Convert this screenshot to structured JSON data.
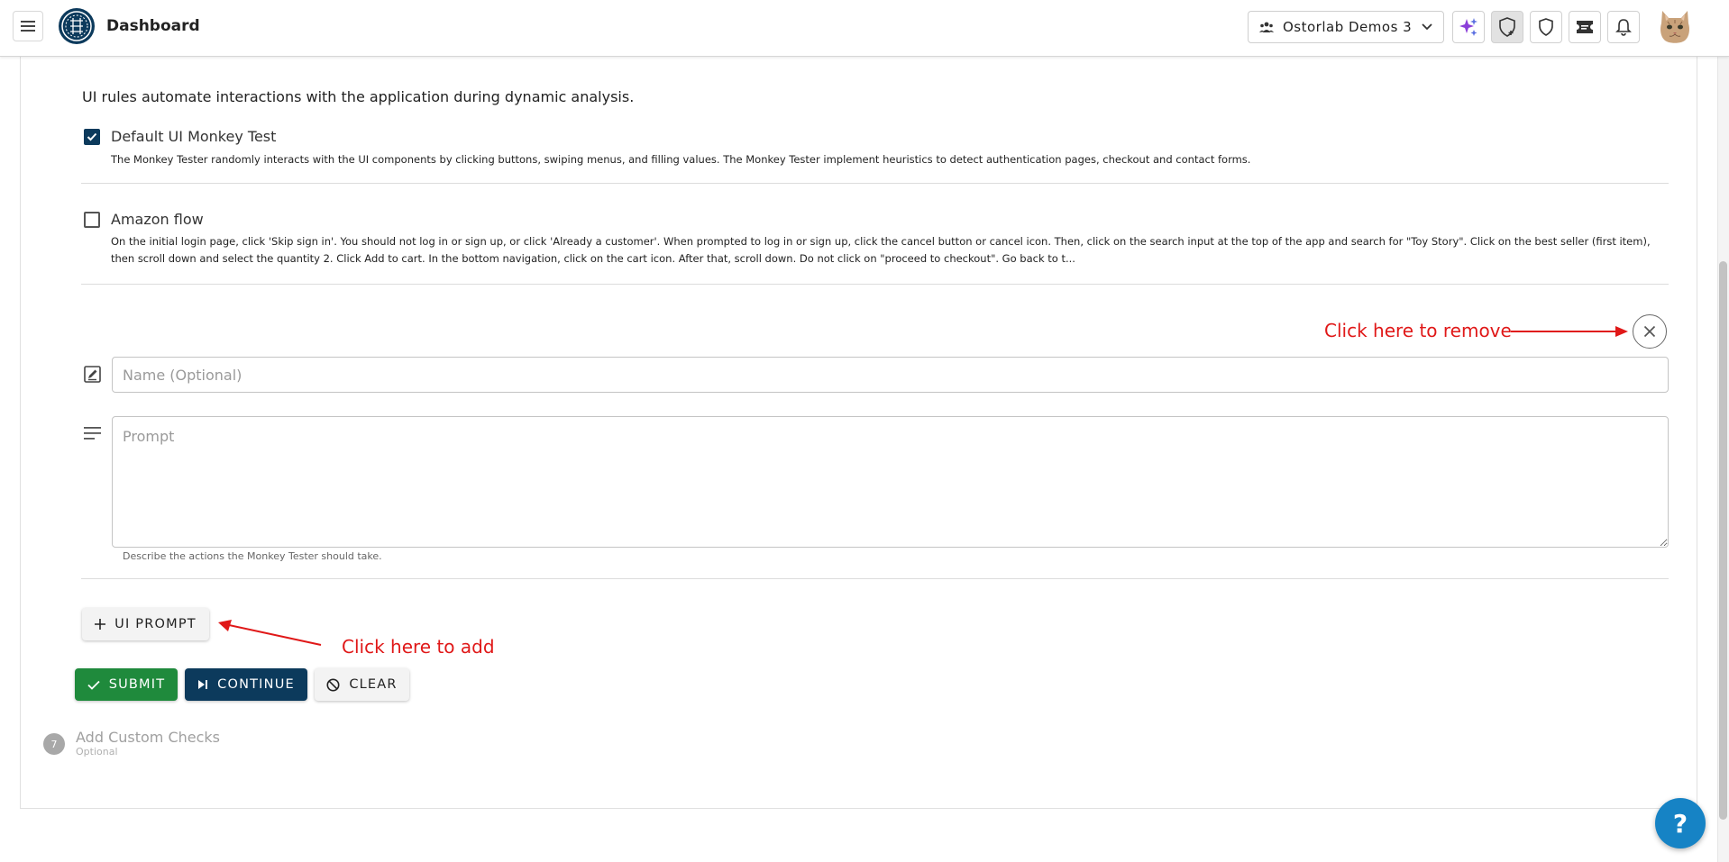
{
  "header": {
    "title": "Dashboard",
    "organization": "Ostorlab Demos 3",
    "icons": [
      "menu-icon",
      "organizations-icon",
      "chevron-down-icon",
      "sparkle-icon",
      "shield-add-icon",
      "shield-icon",
      "ticket-icon",
      "bell-icon"
    ],
    "sparkle_color": "#8b3fd9"
  },
  "ui_rules": {
    "intro": "UI rules automate interactions with the application during dynamic analysis.",
    "rules": [
      {
        "checked": true,
        "title": "Default UI Monkey Test",
        "description": "The Monkey Tester randomly interacts with the UI components by clicking buttons, swiping menus, and filling values. The Monkey Tester implement heuristics to detect authentication pages, checkout and contact forms."
      },
      {
        "checked": false,
        "title": "Amazon flow",
        "description": "On the initial login page, click 'Skip sign in'. You should not log in or sign up, or click 'Already a customer'. When prompted to log in or sign up, click the cancel button or cancel icon. Then, click on the search input at the top of the app and search for \"Toy Story\". Click on the best seller (first item), then scroll down and select the quantity 2. Click Add to cart. In the bottom navigation, click on the cart icon. After that, scroll down. Do not click on \"proceed to checkout\". Go back to t..."
      }
    ],
    "new_prompt": {
      "name_value": "",
      "name_placeholder": "Name (Optional)",
      "prompt_value": "",
      "prompt_placeholder": "Prompt",
      "helper": "Describe the actions the Monkey Tester should take."
    },
    "add_button": "UI PROMPT"
  },
  "annotations": {
    "remove": "Click here to remove",
    "add": "Click here to add",
    "color": "#e01818"
  },
  "actions": {
    "submit": "SUBMIT",
    "continue": "CONTINUE",
    "clear": "CLEAR"
  },
  "next_step": {
    "number": "7",
    "title": "Add Custom Checks",
    "subtitle": "Optional"
  },
  "help": "?",
  "colors": {
    "primary": "#0c3a5c",
    "success": "#1f8a3c",
    "help": "#1683c5"
  }
}
